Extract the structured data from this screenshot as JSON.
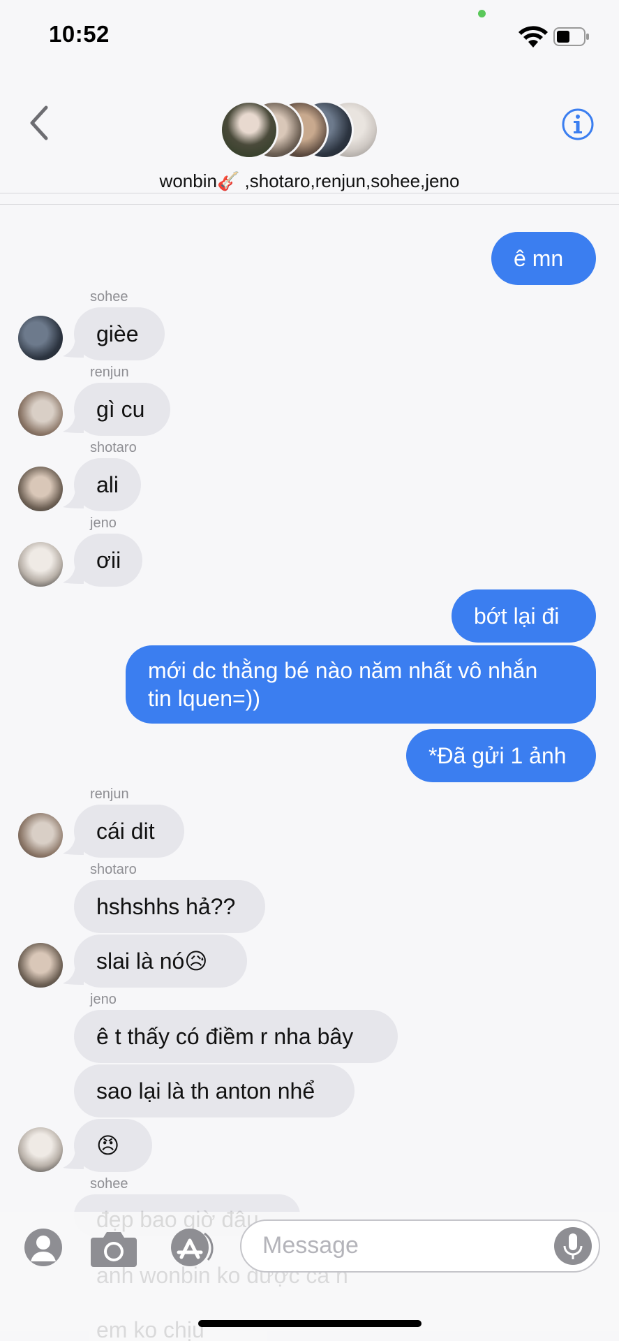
{
  "status_bar": {
    "time": "10:52",
    "wifi_icon": "wifi-icon",
    "battery_icon": "battery-icon"
  },
  "header": {
    "group_names": "wonbin🎸 ,shotaro,renjun,sohee,jeno",
    "back_icon": "chevron-left-icon",
    "info_icon": "info-icon"
  },
  "messages": {
    "m1": "ê mn",
    "sohee1_sender": "sohee",
    "m2": "gièe",
    "renjun1_sender": "renjun",
    "m3": "gì cu",
    "shotaro1_sender": "shotaro",
    "m4": "ali",
    "jeno1_sender": "jeno",
    "m5": "ơii",
    "m6": "bớt lại đi",
    "m7a": "mới dc thằng bé nào năm nhất vô nhắn",
    "m7b": "tin lquen=))",
    "m8": "*Đã gửi 1 ảnh",
    "renjun2_sender": "renjun",
    "m9": "cái dit",
    "shotaro2_sender": "shotaro",
    "m10": "hshshhs hả??",
    "m11": "slai là nó😥",
    "jeno2_sender": "jeno",
    "m12": "ê t thấy có điềm r nha bây",
    "m13": "sao lại là th anton nhể",
    "m14": "😠",
    "sohee2_sender": "sohee",
    "ghost1": "đẹp bao giờ đâu",
    "ghost2": "anh wonbin ko được cà n",
    "ghost3": "em ko chịu"
  },
  "input_bar": {
    "placeholder": "Message",
    "apps_icon": "memoji-icon",
    "camera_icon": "camera-icon",
    "appstore_icon": "app-store-icon",
    "mic_icon": "microphone-icon"
  },
  "colors": {
    "outgoing": "#3b7ef0",
    "incoming": "#e6e6eb",
    "accent": "#3b7ef0"
  }
}
